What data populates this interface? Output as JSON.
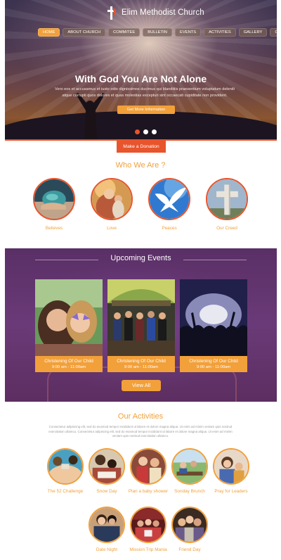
{
  "header": {
    "site_name": "Elim Methodist Church",
    "nav": [
      "HOME",
      "ABOUT CHURCH",
      "COMMITEE",
      "BULLETIN",
      "EVENTS",
      "ACTIVITIES",
      "GALLERY",
      "CONTACT"
    ],
    "active_nav": "HOME"
  },
  "hero": {
    "title": "With God You Are Not Alone",
    "text": "Vero eos et accusamus et iusto odio dignissimos ducimus qui blanditiis praesentium voluptatum deleniti atque corrupti quos dolores et quas molestias excepturi sint occaecati cupiditate non provident.",
    "button": "Get More Information",
    "slides": 3,
    "active_slide": 1
  },
  "donation": {
    "label": "Make a Donation"
  },
  "who": {
    "title": "Who We Are ?",
    "items": [
      {
        "label": "Believes",
        "icon": "believe-stone-image"
      },
      {
        "label": "Love",
        "icon": "mother-child-image"
      },
      {
        "label": "Peaces",
        "icon": "dove-image"
      },
      {
        "label": "Our Creed",
        "icon": "cross-image"
      }
    ]
  },
  "events": {
    "title": "Upcoming Events",
    "items": [
      {
        "name": "Christening Of Our Child",
        "time": "9:00 am - 11:00am"
      },
      {
        "name": "Christening Of Our Child",
        "time": "9:00 am - 11:00am"
      },
      {
        "name": "Christening Of Our Child",
        "time": "9:00 am - 11:00am"
      }
    ],
    "button": "View All"
  },
  "activities": {
    "title": "Our Activities",
    "description": "Consectetur adipiscing elit, sed do eiusmod tempor incididunt ut labore et dolore magna aliqua. Ut enim ad minim veniam quis nostrud exercitation ullamco. Consectetur adipiscing elit, sed do eiusmod tempor incididunt ut labore et dolore magna aliqua. Ut enim ad minim veniam quis nostrud exercitation ullamco.",
    "items": [
      {
        "label": "The 52 Challenge"
      },
      {
        "label": "Snow Day"
      },
      {
        "label": "Plan a baby shower"
      },
      {
        "label": "Sonday Brunch"
      },
      {
        "label": "Pray for Leaders"
      },
      {
        "label": "Date Night"
      },
      {
        "label": "Mission Trip Mania"
      },
      {
        "label": "Friend Day"
      }
    ]
  },
  "colors": {
    "accent": "#f2a03a",
    "brand": "#e8542c",
    "events_bg": "#6a3a78"
  }
}
